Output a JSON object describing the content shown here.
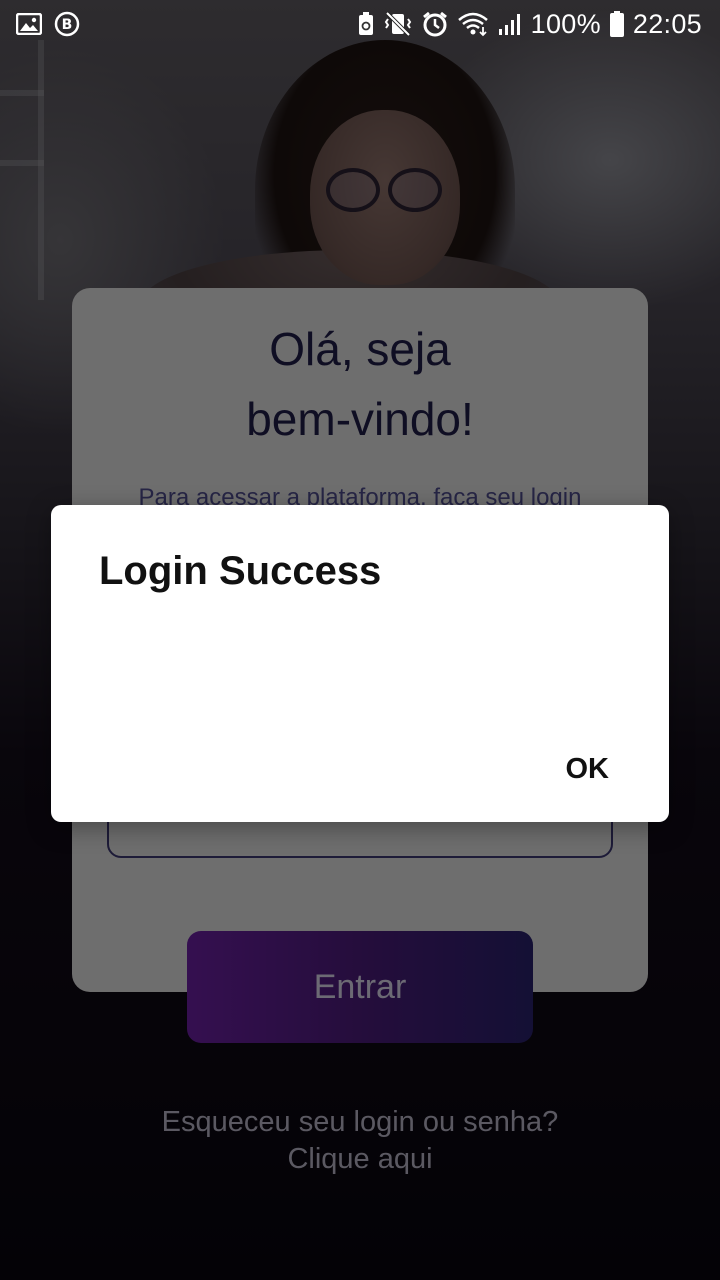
{
  "status_bar": {
    "left_icons": [
      "image-icon",
      "b-badge-icon"
    ],
    "right_icons": [
      "battery-saver-icon",
      "vibrate-mute-icon",
      "alarm-icon",
      "wifi-icon",
      "signal-icon",
      "battery-icon"
    ],
    "battery_percent": "100%",
    "time": "22:05"
  },
  "login_card": {
    "title_line1": "Olá, seja",
    "title_line2": "bem-vindo!",
    "subtitle": "Para acessar a plataforma, faça seu login",
    "submit_label": "Entrar"
  },
  "forgot": {
    "line1": "Esqueceu seu login ou senha?",
    "line2": "Clique aqui"
  },
  "dialog": {
    "title": "Login Success",
    "ok_label": "OK"
  },
  "colors": {
    "title": "#1f1c46",
    "button_gradient_start": "#6a1fa0",
    "button_gradient_end": "#28206a",
    "background": "#0a0610"
  }
}
